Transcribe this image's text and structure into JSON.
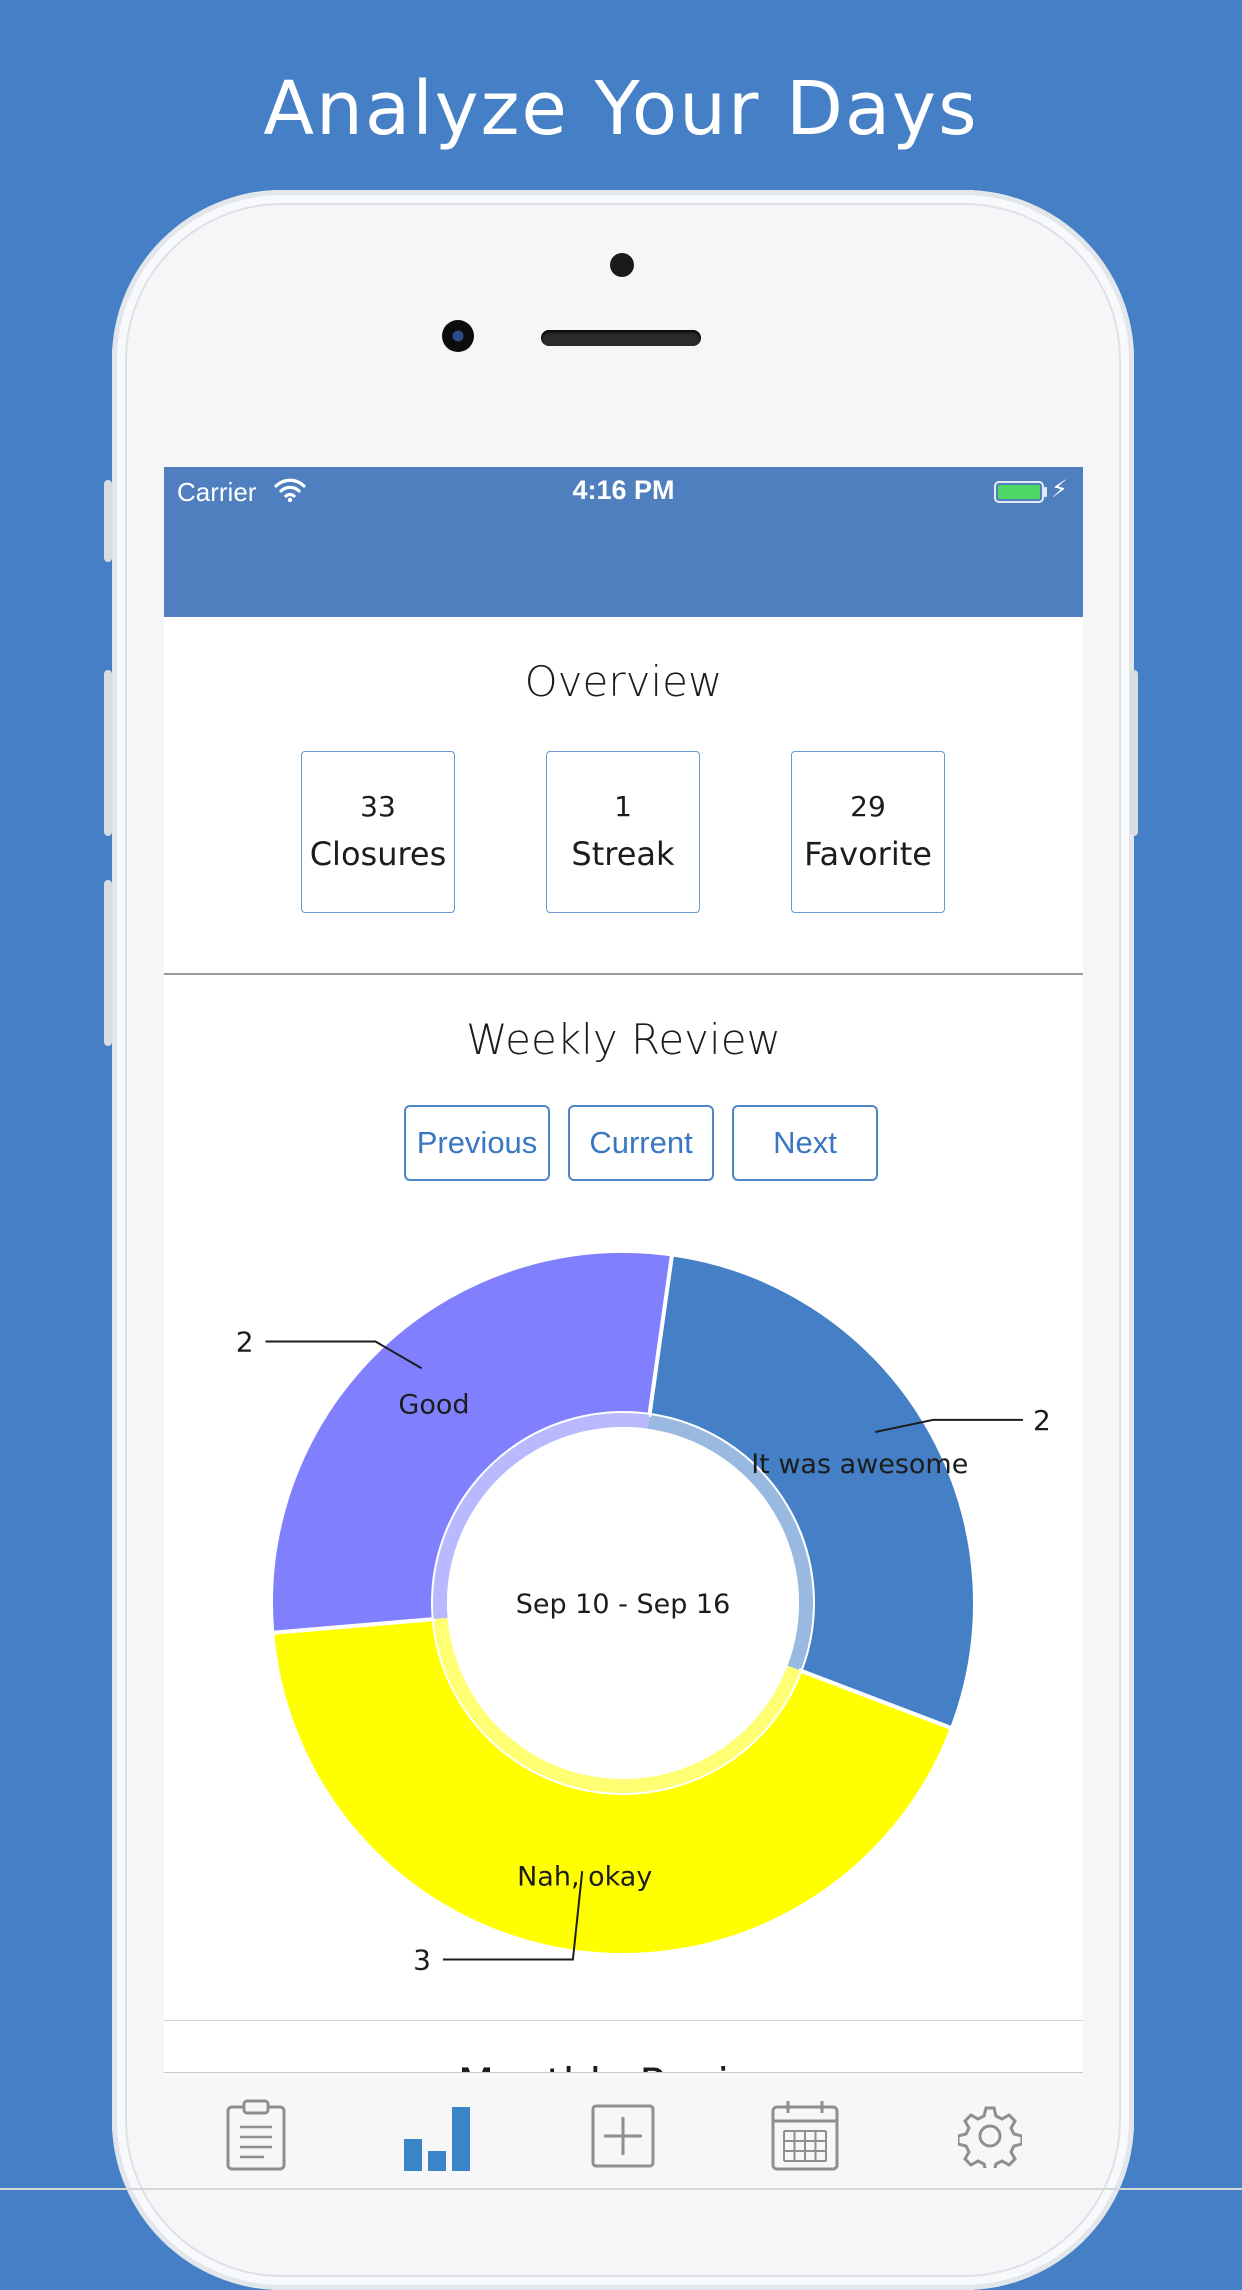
{
  "headline": "Analyze Your Days",
  "status_bar": {
    "carrier": "Carrier",
    "time": "4:16 PM",
    "battery_level": 1.0,
    "charging_icon": "bolt-icon",
    "wifi_icon": "wifi-icon"
  },
  "overview": {
    "title": "Overview",
    "stats": [
      {
        "value": "33",
        "label": "Closures"
      },
      {
        "value": "1",
        "label": "Streak"
      },
      {
        "value": "29",
        "label": "Favorite"
      }
    ]
  },
  "weekly_review": {
    "title": "Weekly Review",
    "buttons": {
      "previous": "Previous",
      "current": "Current",
      "next": "Next"
    },
    "date_range": "Sep 10 - Sep 16"
  },
  "chart_data": {
    "type": "pie",
    "center_label": "Sep 10 - Sep 16",
    "slices": [
      {
        "label": "It was awesome",
        "value": 2,
        "color": "#4580c6"
      },
      {
        "label": "Nah, okay",
        "value": 3,
        "color": "#ffff00"
      },
      {
        "label": "Good",
        "value": 2,
        "color": "#8080ff"
      }
    ]
  },
  "next_section": {
    "title": "Monthly Review"
  },
  "tab_bar": {
    "tabs": [
      {
        "icon": "clipboard-icon",
        "active": false
      },
      {
        "icon": "bar-chart-icon",
        "active": true
      },
      {
        "icon": "add-icon",
        "active": false
      },
      {
        "icon": "calendar-icon",
        "active": false
      },
      {
        "icon": "gear-icon",
        "active": false
      }
    ],
    "active_color": "#3a84c9",
    "inactive_color": "#8e8e93"
  },
  "colors": {
    "background": "#4580c6",
    "navbar": "#4f7fbf",
    "accent": "#4f86c8"
  }
}
